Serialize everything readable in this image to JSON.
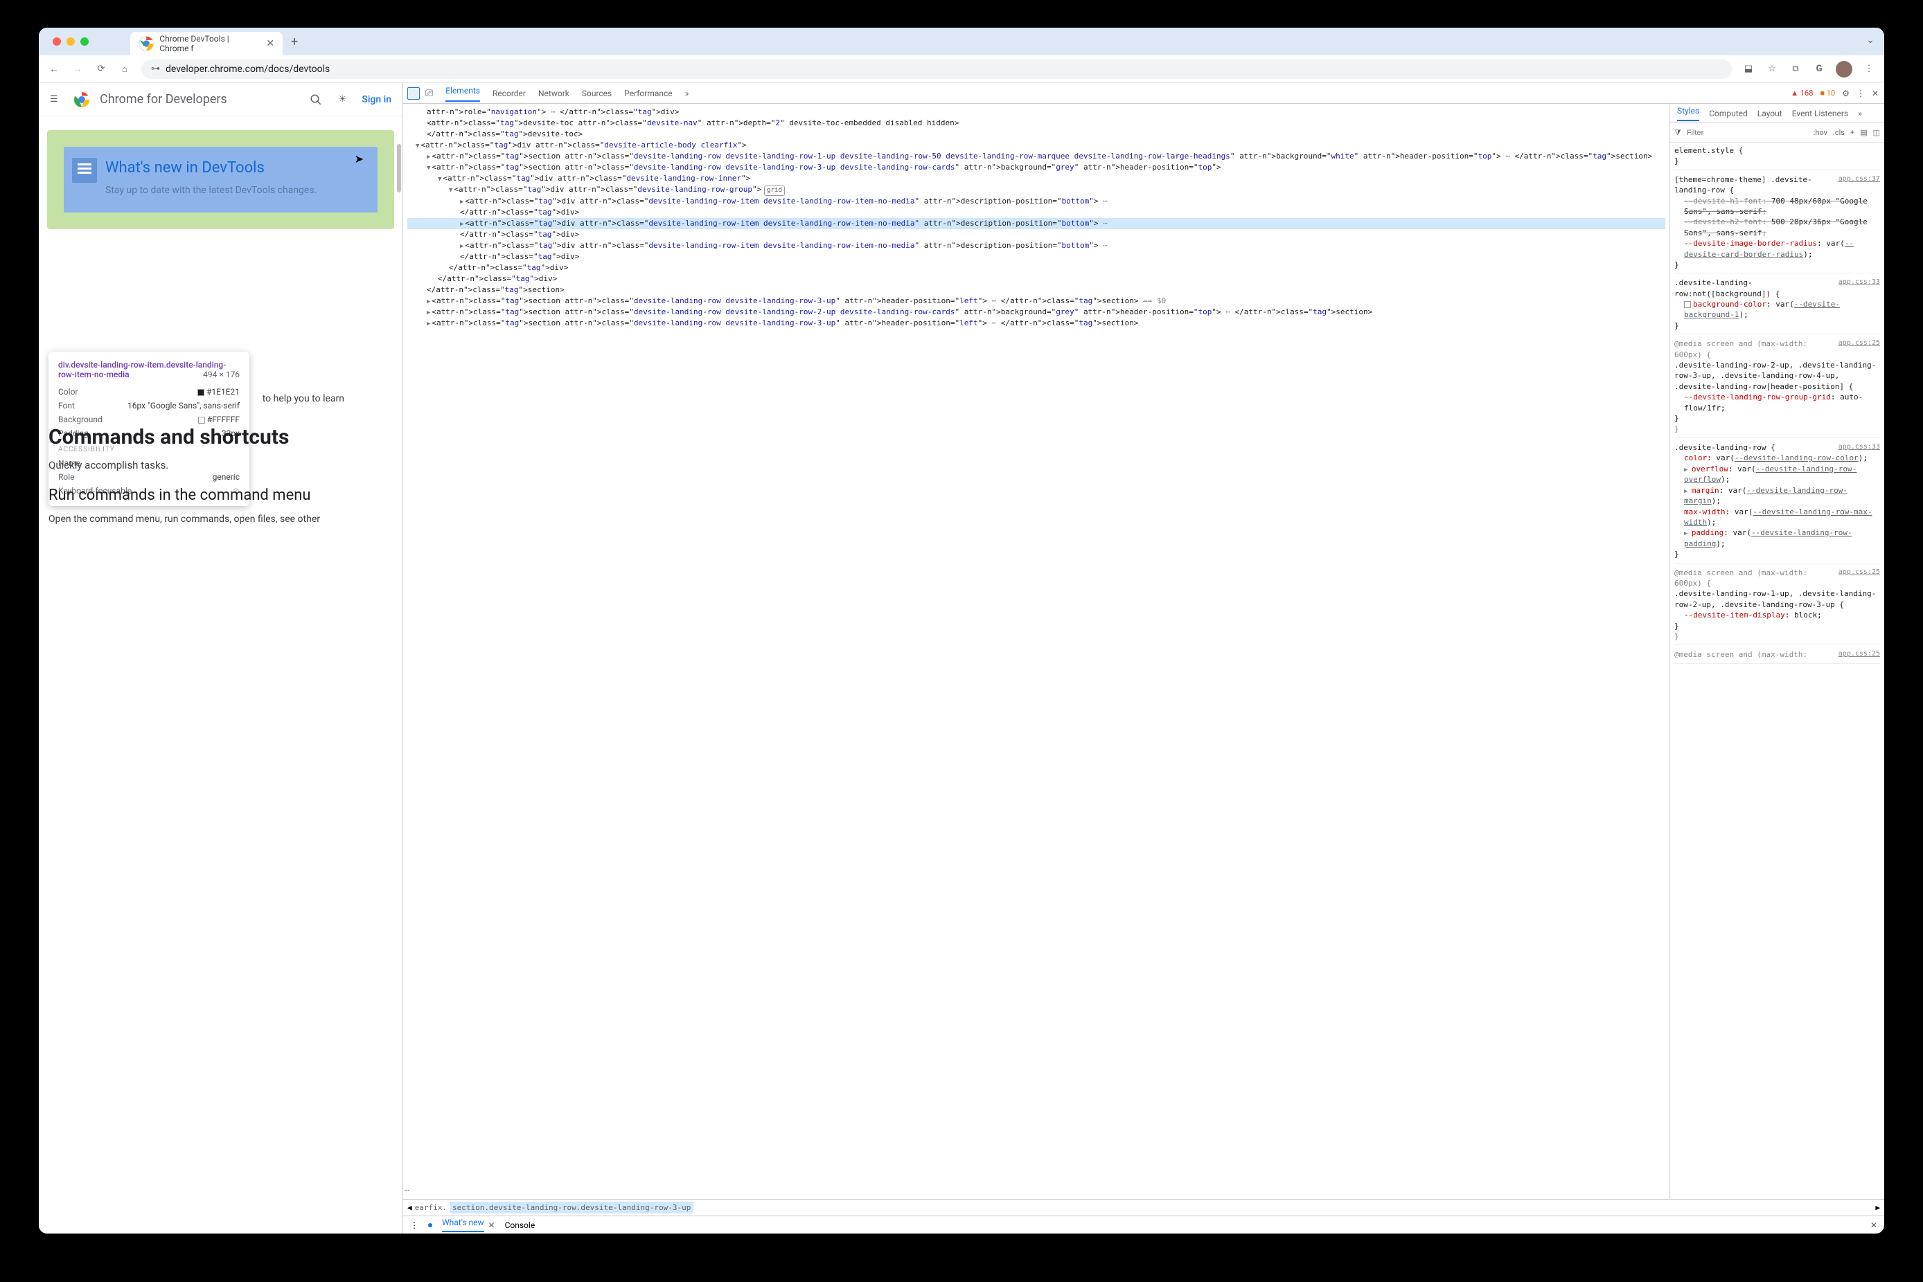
{
  "browser": {
    "tab_title": "Chrome DevTools  |  Chrome f",
    "url": "developer.chrome.com/docs/devtools"
  },
  "page": {
    "brand": "Chrome for Developers",
    "signin": "Sign in",
    "card_title": "What's new in DevTools",
    "card_subtitle": "Stay up to date with the latest DevTools changes.",
    "teaser_text": " to help you to learn",
    "commands_heading": "Commands and shortcuts",
    "commands_sub": "Quickly accomplish tasks.",
    "run_cmds_heading": "Run commands in the command menu",
    "run_cmds_text": "Open the command menu, run commands, open files, see other"
  },
  "tooltip": {
    "selector": "div.devsite-landing-row-item.devsite-landing-row-item-no-media",
    "dims": "494 × 176",
    "color_label": "Color",
    "color_value": "#1E1E21",
    "font_label": "Font",
    "font_value": "16px \"Google Sans\", sans-serif",
    "bg_label": "Background",
    "bg_value": "#FFFFFF",
    "padding_label": "Padding",
    "padding_value": "32px",
    "a11y_heading": "ACCESSIBILITY",
    "name_label": "Name",
    "role_label": "Role",
    "role_value": "generic",
    "kb_label": "Keyboard-focusable"
  },
  "devtools": {
    "top_tabs": [
      "Elements",
      "Recorder",
      "Network",
      "Sources",
      "Performance"
    ],
    "err_count": "168",
    "warn_count": "10",
    "styles_tabs": [
      "Styles",
      "Computed",
      "Layout",
      "Event Listeners"
    ],
    "filter_placeholder": "Filter",
    "hov": ":hov",
    "cls": ".cls",
    "drawer_tabs": [
      "What's new",
      "Console"
    ],
    "breadcrumb_prefix": "earfix.",
    "breadcrumb_active": "section.devsite-landing-row.devsite-landing-row-3-up"
  },
  "elements_tree": [
    {
      "ind": 1,
      "raw": "role=\"navigation\"> … </div>"
    },
    {
      "ind": 1,
      "raw": "<devsite-toc class=\"devsite-nav\" depth=\"2\" devsite-toc-embedded disabled hidden>"
    },
    {
      "ind": 1,
      "raw": "</devsite-toc>"
    },
    {
      "ind": 0,
      "tri": "▼",
      "raw": "<div class=\"devsite-article-body clearfix\">"
    },
    {
      "ind": 1,
      "tri": "▶",
      "raw": "<section class=\"devsite-landing-row devsite-landing-row-1-up devsite-landing-row-50 devsite-landing-row-marquee devsite-landing-row-large-headings\" background=\"white\" header-position=\"top\"> … </section>"
    },
    {
      "ind": 1,
      "tri": "▼",
      "raw": "<section class=\"devsite-landing-row devsite-landing-row-3-up devsite-landing-row-cards\" background=\"grey\" header-position=\"top\">"
    },
    {
      "ind": 2,
      "tri": "▼",
      "raw": "<div class=\"devsite-landing-row-inner\">"
    },
    {
      "ind": 3,
      "tri": "▼",
      "raw": "<div class=\"devsite-landing-row-group\">",
      "badge": "grid"
    },
    {
      "ind": 4,
      "tri": "▶",
      "raw": "<div class=\"devsite-landing-row-item devsite-landing-row-item-no-media\" description-position=\"bottom\"> …"
    },
    {
      "ind": 4,
      "raw": "</div>"
    },
    {
      "ind": 4,
      "tri": "▶",
      "highlight": true,
      "raw": "<div class=\"devsite-landing-row-item devsite-landing-row-item-no-media\" description-position=\"bottom\"> …"
    },
    {
      "ind": 4,
      "raw": "</div>"
    },
    {
      "ind": 4,
      "tri": "▶",
      "raw": "<div class=\"devsite-landing-row-item devsite-landing-row-item-no-media\" description-position=\"bottom\"> …"
    },
    {
      "ind": 4,
      "raw": "</div>"
    },
    {
      "ind": 3,
      "raw": "</div>"
    },
    {
      "ind": 2,
      "raw": "</div>"
    },
    {
      "ind": 1,
      "raw": "</section>"
    },
    {
      "ind": 1,
      "tri": "▶",
      "raw": "<section class=\"devsite-landing-row devsite-landing-row-3-up\" header-position=\"left\"> … </section> == $0",
      "eq0": true
    },
    {
      "ind": 1,
      "tri": "▶",
      "raw": "<section class=\"devsite-landing-row devsite-landing-row-2-up devsite-landing-row-cards\" background=\"grey\" header-position=\"top\"> … </section>"
    },
    {
      "ind": 1,
      "tri": "▶",
      "raw": "<section class=\"devsite-landing-row devsite-landing-row-3-up\" header-position=\"left\"> … </section>"
    }
  ],
  "styles_rules": [
    {
      "selector": "element.style {",
      "props": [],
      "close": "}"
    },
    {
      "selector": "[theme=chrome-theme] .devsite-landing-row {",
      "src": "app.css:37",
      "props": [
        {
          "struck": true,
          "n": "--devsite-h1-font",
          "v": "700 48px/60px \"Google Sans\", sans-serif"
        },
        {
          "struck": true,
          "n": "--devsite-h2-font",
          "v": "500 28px/36px \"Google Sans\", sans-serif"
        },
        {
          "n": "--devsite-image-border-radius",
          "v": "var(--devsite-card-border-radius)"
        }
      ],
      "close": "}"
    },
    {
      "selector": ".devsite-landing-row:not([background]) {",
      "src": "app.css:33",
      "props": [
        {
          "n": "background-color",
          "v": "var(--devsite-background-1)",
          "checkbox": true
        }
      ],
      "close": "}"
    },
    {
      "media": "@media screen and (max-width: 600px) {",
      "src": "app.css:25",
      "selector": ".devsite-landing-row-2-up, .devsite-landing-row-3-up, .devsite-landing-row-4-up, .devsite-landing-row[header-position] {",
      "props": [
        {
          "n": "--devsite-landing-row-group-grid",
          "v": "auto-flow/1fr"
        }
      ],
      "close": "}",
      "media_close": "}"
    },
    {
      "selector": ".devsite-landing-row {",
      "src": "app.css:33",
      "props": [
        {
          "n": "color",
          "v": "var(--devsite-landing-row-color)"
        },
        {
          "n": "overflow",
          "v": "var(--devsite-landing-row-overflow)",
          "arrow": true
        },
        {
          "n": "margin",
          "v": "var(--devsite-landing-row-margin)",
          "arrow": true
        },
        {
          "n": "max-width",
          "v": "var(--devsite-landing-row-max-width)"
        },
        {
          "n": "padding",
          "v": "var(--devsite-landing-row-padding)",
          "arrow": true
        }
      ],
      "close": "}"
    },
    {
      "media": "@media screen and (max-width: 600px) {",
      "src": "app.css:25",
      "selector": ".devsite-landing-row-1-up, .devsite-landing-row-2-up, .devsite-landing-row-3-up {",
      "props": [
        {
          "n": "--devsite-item-display",
          "v": "block"
        }
      ],
      "close": "}",
      "media_close": "}"
    },
    {
      "media": "@media screen and (max-width:",
      "src": "app.css:25"
    }
  ]
}
